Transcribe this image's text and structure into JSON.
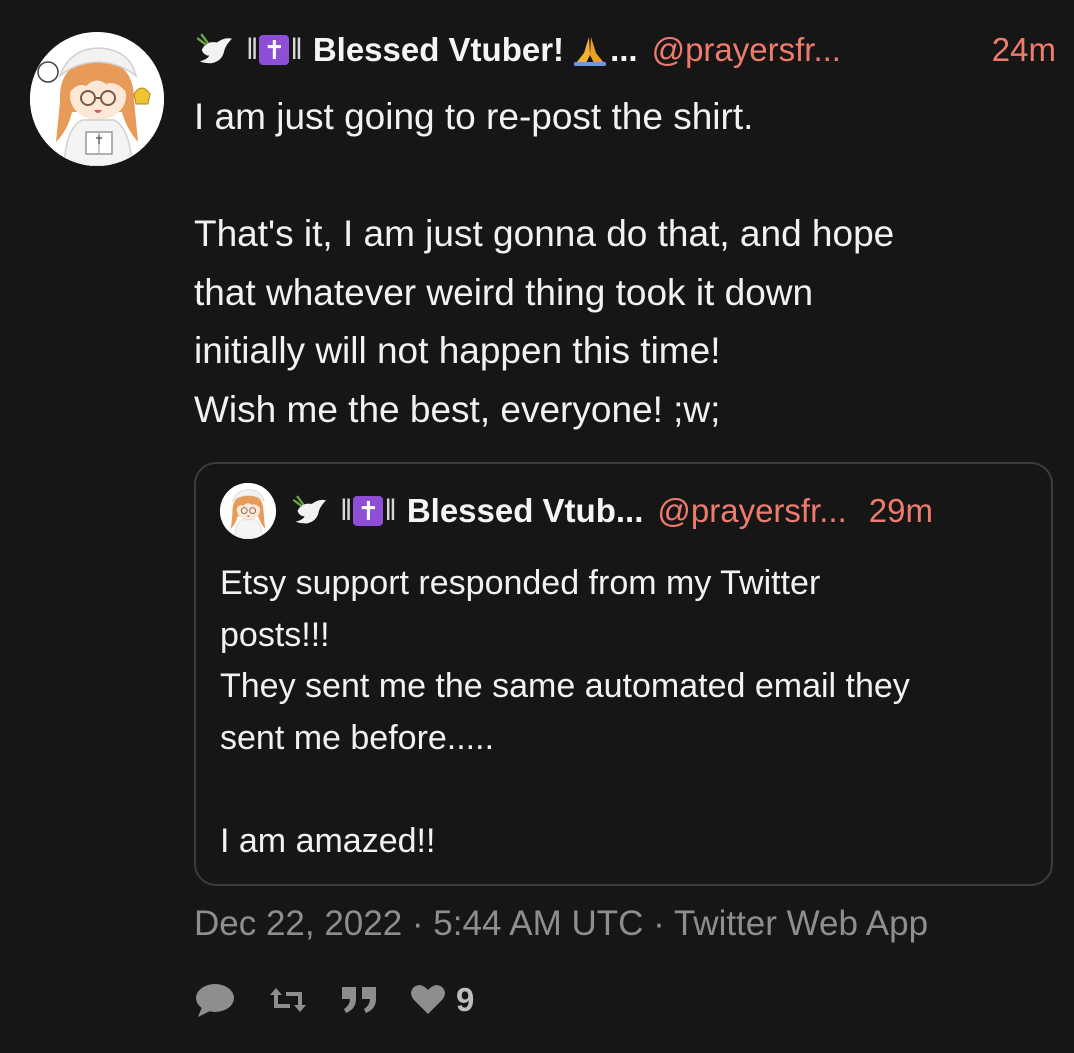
{
  "tweet": {
    "display_name": "Blessed Vtuber!",
    "name_truncation": "...",
    "handle": "@prayersfr...",
    "time": "24m",
    "name_bars_left": "‖",
    "name_bars_right": "‖",
    "cross": "✝",
    "body_paragraph_1": "I am just going to re-post the shirt.",
    "body_lines": [
      "That's it, I am just gonna do that, and hope",
      "that whatever weird thing took it down",
      "initially will not happen this time!",
      "Wish me the best, everyone! ;w;"
    ],
    "meta": "Dec 22, 2022 · 5:44 AM UTC · Twitter Web App",
    "like_count": "9"
  },
  "quoted": {
    "display_name": "Blessed Vtub...",
    "handle": "@prayersfr...",
    "time": "29m",
    "lines_1": [
      "Etsy support responded from my Twitter",
      "posts!!!",
      "They sent me the same automated email they",
      "sent me before....."
    ],
    "line_last": "I am amazed!!"
  },
  "icons": {
    "dove": "dove-icon",
    "cross": "latin-cross-icon",
    "pray": "folded-hands-icon",
    "reply": "comment-icon",
    "retweet": "retweet-icon",
    "quote": "quote-icon",
    "like": "heart-icon"
  },
  "colors": {
    "background": "#161616",
    "accent": "#ef7b6c",
    "muted": "#8e8e8e",
    "cross_badge": "#8e4fd6"
  }
}
